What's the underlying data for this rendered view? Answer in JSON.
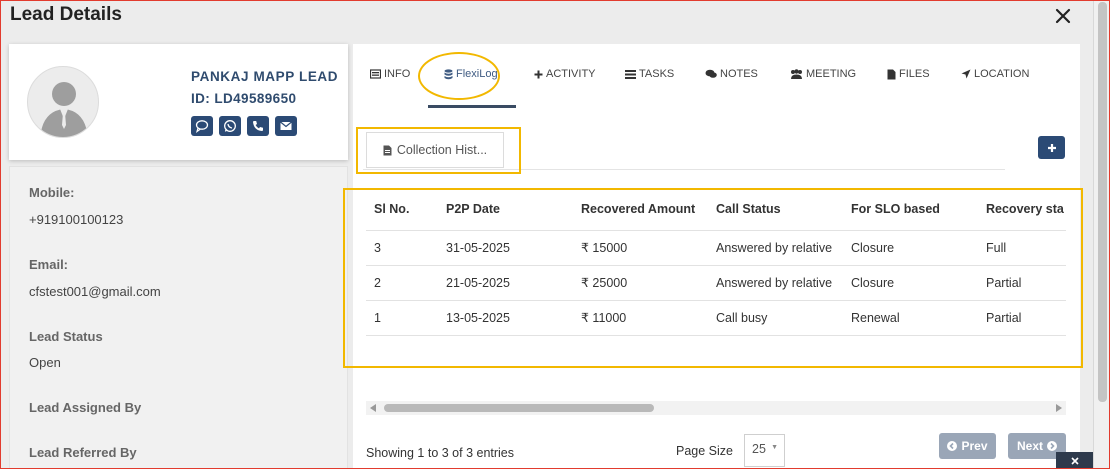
{
  "modal": {
    "title": "Lead Details"
  },
  "profile": {
    "name": "PANKAJ MAPP LEAD",
    "lead_id": "ID: LD49589650"
  },
  "details": [
    {
      "label": "Mobile:",
      "value": "+919100100123"
    },
    {
      "label": "Email:",
      "value": "cfstest001@gmail.com"
    },
    {
      "label": "Lead Status",
      "value": "Open"
    },
    {
      "label": "Lead Assigned By",
      "value": ""
    },
    {
      "label": "Lead Referred By",
      "value": ""
    }
  ],
  "tabs": [
    {
      "label": "INFO",
      "icon": "id-card-icon"
    },
    {
      "label": "FlexiLog",
      "icon": "database-icon",
      "active": true
    },
    {
      "label": "ACTIVITY",
      "icon": "plus-icon"
    },
    {
      "label": "TASKS",
      "icon": "tasks-icon"
    },
    {
      "label": "NOTES",
      "icon": "comments-icon"
    },
    {
      "label": "MEETING",
      "icon": "users-icon"
    },
    {
      "label": "FILES",
      "icon": "file-icon"
    },
    {
      "label": "LOCATION",
      "icon": "location-arrow-icon"
    }
  ],
  "subtab": {
    "label": "Collection Hist..."
  },
  "table": {
    "columns": [
      "Sl No.",
      "P2P Date",
      "Recovered Amount",
      "Call Status",
      "For SLO based",
      "Recovery sta"
    ],
    "rows": [
      [
        "3",
        "31-05-2025",
        "₹ 15000",
        "Answered by relative",
        "Closure",
        "Full"
      ],
      [
        "2",
        "21-05-2025",
        "₹ 25000",
        "Answered by relative",
        "Closure",
        "Partial"
      ],
      [
        "1",
        "13-05-2025",
        "₹ 11000",
        "Call busy",
        "Renewal",
        "Partial"
      ]
    ]
  },
  "footer": {
    "info": "Showing 1 to 3 of 3 entries",
    "page_size_label": "Page Size",
    "page_size_value": "25",
    "prev_label": "Prev",
    "next_label": "Next"
  },
  "colors": {
    "primary": "#2b4a75",
    "highlight": "#f2b800",
    "disabled_button": "#9aa6b7"
  }
}
